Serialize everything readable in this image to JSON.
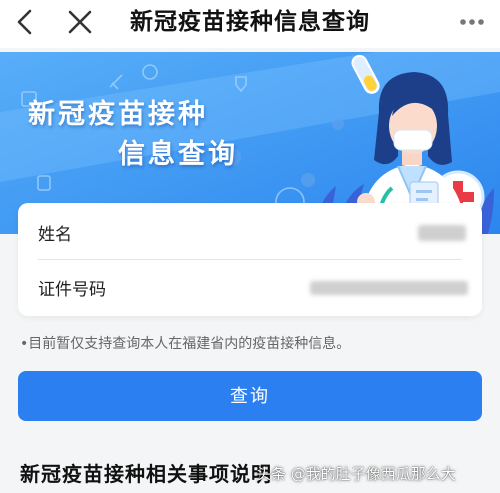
{
  "topbar": {
    "title": "新冠疫苗接种信息查询",
    "back_icon": "chevron-left-icon",
    "close_icon": "close-icon",
    "more_icon": "more-icon"
  },
  "banner": {
    "line1": "新冠疫苗接种",
    "line2": "信息查询",
    "colors": {
      "sky": "#2a8cf0",
      "light": "#67b7ff"
    }
  },
  "form": {
    "name_label": "姓名",
    "id_label": "证件号码"
  },
  "notice": "•目前暂仅支持查询本人在福建省内的疫苗接种信息。",
  "query_button": "查询",
  "section_title": "新冠疫苗接种相关事项说明",
  "watermark": "头条 @我的肚子像西瓜那么大",
  "colors": {
    "accent": "#2b7ff0"
  }
}
